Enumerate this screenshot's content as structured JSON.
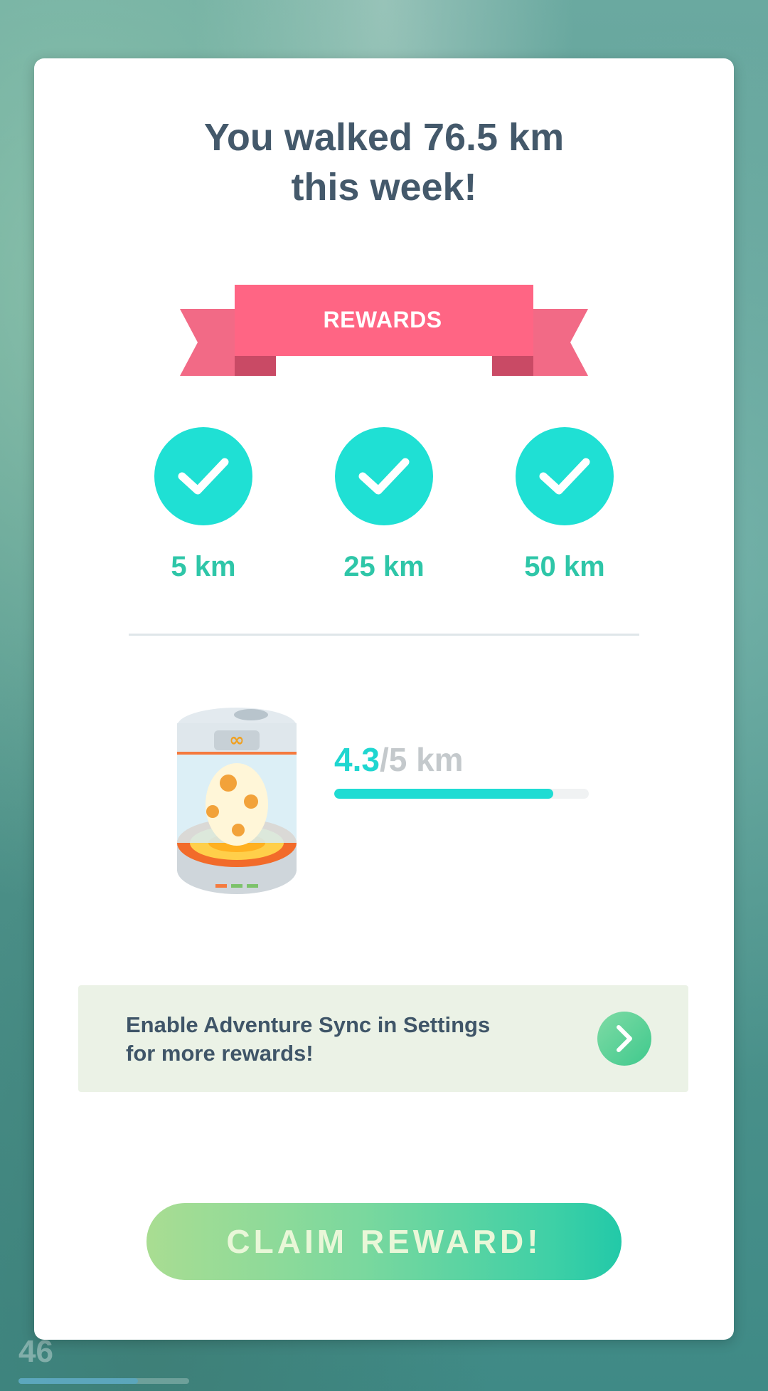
{
  "title": "You walked 76.5 km\nthis week!",
  "rewards_banner": {
    "label": "REWARDS",
    "color": "#ff6584"
  },
  "milestones": [
    {
      "label": "5 km",
      "completed": true
    },
    {
      "label": "25 km",
      "completed": true
    },
    {
      "label": "50 km",
      "completed": true
    }
  ],
  "progress": {
    "current": "4.3",
    "total_label": "/5 km",
    "fraction": 0.86
  },
  "sync_banner": {
    "text": "Enable Adventure Sync in Settings for more rewards!",
    "icon": "chevron-right-icon"
  },
  "claim_button": {
    "label": "CLAIM REWARD!"
  },
  "hud": {
    "level": "46"
  },
  "colors": {
    "accent": "#1fe0d4",
    "milestone_text": "#2ec6a8",
    "title_text": "#44596b"
  }
}
